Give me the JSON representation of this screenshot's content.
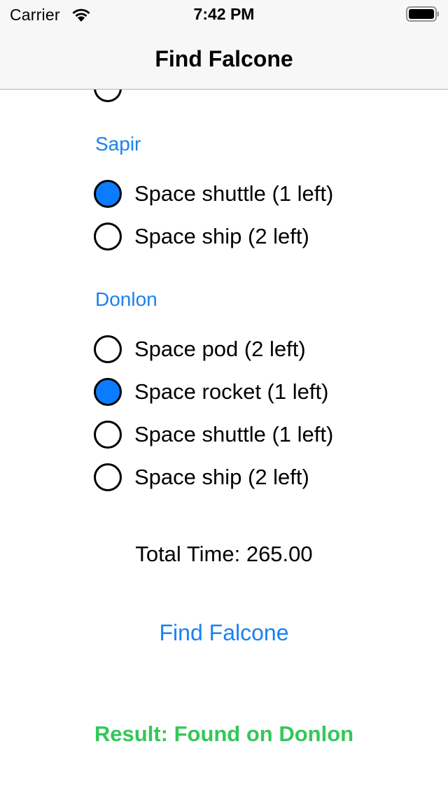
{
  "status_bar": {
    "carrier": "Carrier",
    "time": "7:42 PM"
  },
  "nav": {
    "title": "Find Falcone"
  },
  "planets": [
    {
      "name": "Sapir",
      "options": [
        {
          "label": "Space shuttle (1 left)",
          "selected": true
        },
        {
          "label": "Space ship (2 left)",
          "selected": false
        }
      ]
    },
    {
      "name": "Donlon",
      "options": [
        {
          "label": "Space pod (2 left)",
          "selected": false
        },
        {
          "label": "Space rocket (1 left)",
          "selected": true
        },
        {
          "label": "Space shuttle (1 left)",
          "selected": false
        },
        {
          "label": "Space ship (2 left)",
          "selected": false
        }
      ]
    }
  ],
  "total_time": "Total Time: 265.00",
  "find_button": "Find Falcone",
  "result": "Result: Found on Donlon",
  "colors": {
    "accent": "#1a82f0",
    "radio_selected": "#0b7cff",
    "success": "#34c759"
  }
}
